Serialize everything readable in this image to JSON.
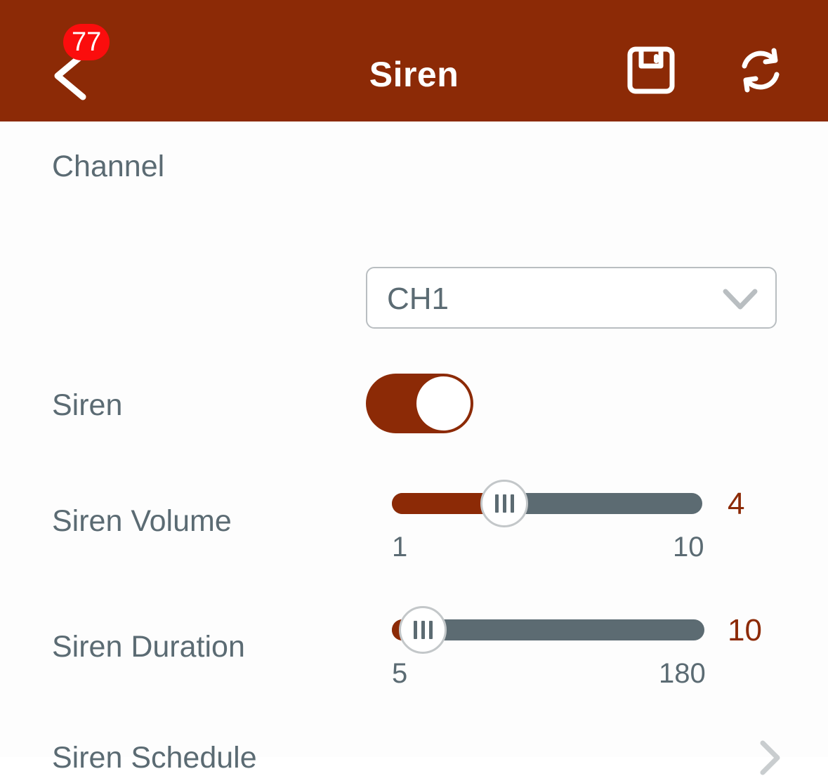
{
  "header": {
    "title": "Siren",
    "back_badge_count": "77",
    "back_icon": "chevron-left-icon",
    "save_icon": "save-floppy-icon",
    "refresh_icon": "refresh-sync-icon",
    "background_color": "#8c2a06",
    "badge_color": "#fb0d0d",
    "text_color": "#ffffff"
  },
  "theme": {
    "accent": "#8c2a06",
    "label_color": "#5b6b73",
    "track_color": "#5c6b72",
    "background": "#fdfdfd"
  },
  "channel": {
    "label": "Channel",
    "selected_value": "CH1",
    "chevron_icon": "chevron-down-icon"
  },
  "siren_toggle": {
    "label": "Siren",
    "state": "on"
  },
  "siren_volume": {
    "label": "Siren Volume",
    "value": "4",
    "min": "1",
    "max": "10"
  },
  "siren_duration": {
    "label": "Siren Duration",
    "value": "10",
    "min": "5",
    "max": "180"
  },
  "siren_schedule": {
    "label": "Siren Schedule",
    "chevron_icon": "chevron-right-icon"
  }
}
